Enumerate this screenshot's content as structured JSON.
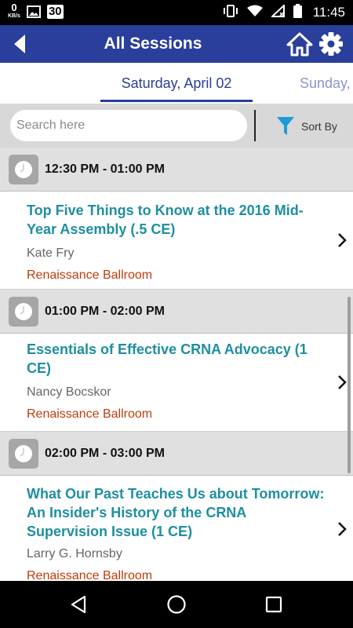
{
  "status_bar": {
    "speed_value": "0",
    "speed_unit": "KB/s",
    "calendar_day": "30",
    "time": "11:45"
  },
  "header": {
    "title": "All Sessions"
  },
  "date_tabs": [
    {
      "label": "Saturday, April 02",
      "active": true
    },
    {
      "label": "Sunday,",
      "active": false
    }
  ],
  "search": {
    "placeholder": "Search here",
    "value": ""
  },
  "sort": {
    "label": "Sort By"
  },
  "groups": [
    {
      "time": "12:30 PM - 01:00 PM",
      "sessions": [
        {
          "title": "Top Five Things to Know at the 2016 Mid-Year Assembly (.5 CE)",
          "speaker": "Kate Fry",
          "room": "Renaissance Ballroom"
        }
      ]
    },
    {
      "time": "01:00 PM - 02:00 PM",
      "sessions": [
        {
          "title": "Essentials of Effective CRNA Advocacy (1 CE)",
          "speaker": "Nancy Bocskor",
          "room": "Renaissance Ballroom"
        }
      ]
    },
    {
      "time": "02:00 PM - 03:00 PM",
      "sessions": [
        {
          "title": "What Our Past Teaches Us about Tomorrow: An Insider's History of the CRNA Supervision Issue (1 CE)",
          "speaker": "Larry G. Hornsby",
          "room": "Renaissance Ballroom"
        }
      ]
    }
  ],
  "colors": {
    "primary": "#2a3e9b",
    "title_teal": "#1e8fa0",
    "room_orange": "#c23b0c",
    "sort_icon": "#1e9bd7"
  },
  "icons": {
    "back": "back-arrow-icon",
    "home": "home-icon",
    "settings": "gear-icon",
    "filter": "filter-icon",
    "clock": "clock-icon",
    "chevron": "chevron-right-icon"
  }
}
